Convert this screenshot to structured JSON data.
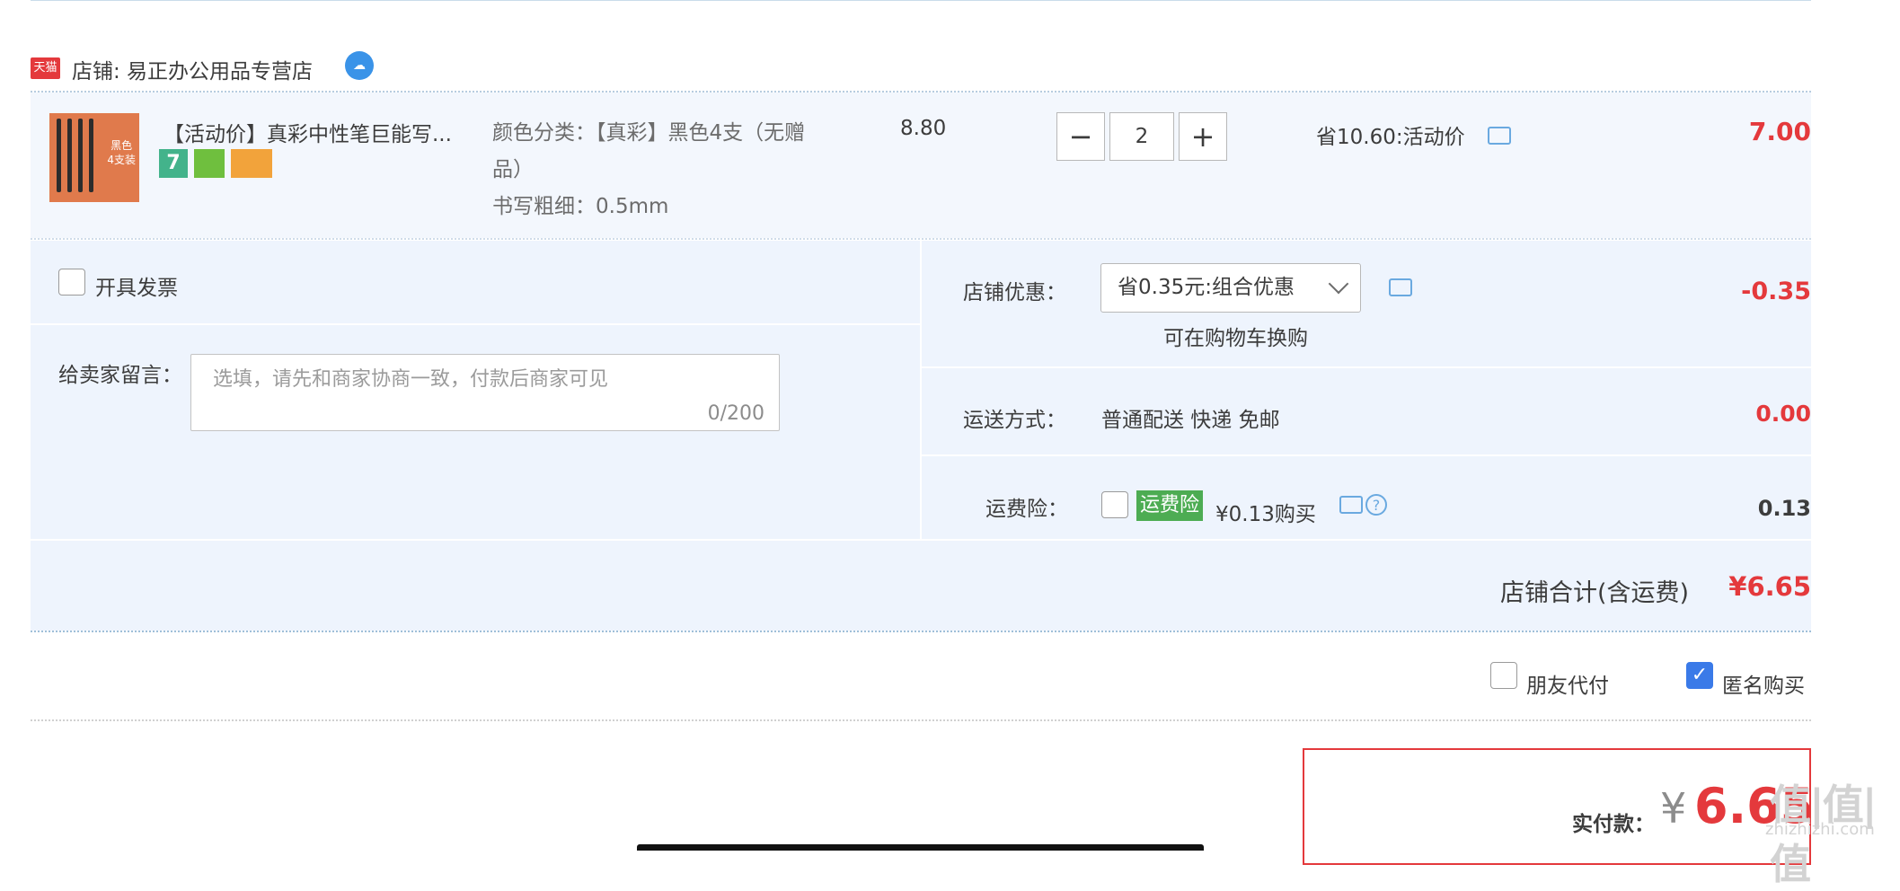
{
  "shop": {
    "badge": "天猫",
    "label": "店铺: 易正办公用品专营店",
    "wangwang_icon": "wangwang-chat-icon"
  },
  "item": {
    "thumb_text_1": "黑色",
    "thumb_text_2": "4支装",
    "title": "【活动价】真彩中性笔巨能写...",
    "badge_7": "7",
    "sku_color": "颜色分类：【真彩】黑色4支（无赠品）",
    "sku_size": "书写粗细：0.5mm",
    "price": "8.80",
    "minus": "−",
    "quantity": "2",
    "plus": "+",
    "promo": "省10.60:活动价",
    "subtotal": "7.00"
  },
  "invoice": {
    "label": "开具发票"
  },
  "message": {
    "label": "给卖家留言：",
    "placeholder": "选填，请先和商家协商一致，付款后商家可见",
    "counter": "0/200"
  },
  "shop_discount": {
    "label": "店铺优惠：",
    "selected": "省0.35元:组合优惠",
    "note": "可在购物车换购",
    "amount": "-0.35"
  },
  "shipping": {
    "label": "运送方式：",
    "value": "普通配送 快递 免邮",
    "amount": "0.00"
  },
  "insurance": {
    "label": "运费险：",
    "tag": "运费险",
    "price": "¥0.13购买",
    "help": "?",
    "amount": "0.13"
  },
  "shop_total": {
    "label": "店铺合计(含运费)",
    "amount": "¥6.65"
  },
  "options": {
    "friend_pay": "朋友代付",
    "anonymous": "匿名购买",
    "check_mark": "✓"
  },
  "payment": {
    "label": "实付款：",
    "currency": "¥",
    "amount": "6.65"
  },
  "watermark": {
    "text": "值|值|值",
    "site": "zhizhizhi.com"
  },
  "colors": {
    "accent_red": "#e4393c",
    "panel_bg": "#eef4fd",
    "link_blue": "#6aa9e0"
  }
}
